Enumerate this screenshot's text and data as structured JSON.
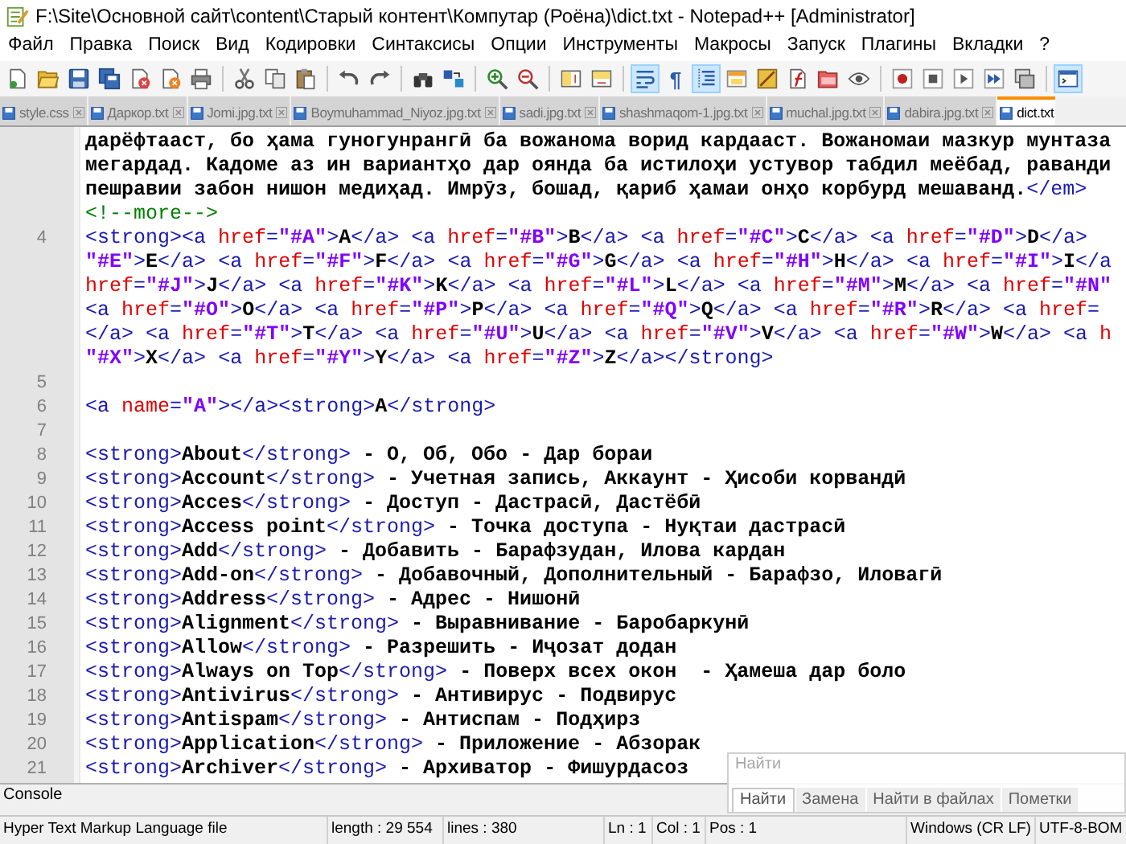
{
  "window": {
    "title": "F:\\Site\\Основной сайт\\content\\Старый контент\\Компутар (Роёна)\\dict.txt - Notepad++ [Administrator]"
  },
  "menu": [
    "Файл",
    "Правка",
    "Поиск",
    "Вид",
    "Кодировки",
    "Синтаксисы",
    "Опции",
    "Инструменты",
    "Макросы",
    "Запуск",
    "Плагины",
    "Вкладки",
    "?"
  ],
  "toolbar": [
    {
      "on": false
    },
    {
      "on": false
    },
    {
      "on": false
    },
    {
      "on": false
    },
    {
      "on": false
    },
    {
      "on": false
    },
    {
      "on": false
    },
    {
      "on": false
    },
    {
      "on": false
    },
    {
      "on": false
    },
    {
      "on": false
    },
    {
      "on": false
    },
    {
      "on": false
    },
    {
      "on": false
    },
    {
      "on": false
    },
    {
      "on": false
    },
    {
      "on": false
    },
    {
      "on": false
    },
    {
      "on": true
    },
    {
      "on": false,
      "symbol": "¶"
    },
    {
      "on": true
    },
    {
      "on": false
    },
    {
      "on": false
    },
    {
      "on": false
    },
    {
      "on": false
    },
    {
      "on": false
    },
    {
      "on": false
    },
    {
      "on": false
    },
    {
      "on": false
    },
    {
      "on": false
    },
    {
      "on": false
    },
    {
      "on": true
    }
  ],
  "tabs": [
    {
      "label": "style.css",
      "selected": false
    },
    {
      "label": "Даркор.txt",
      "selected": false
    },
    {
      "label": "Jomi.jpg.txt",
      "selected": false
    },
    {
      "label": "Boymuhammad_Niyoz.jpg.txt",
      "selected": false
    },
    {
      "label": "sadi.jpg.txt",
      "selected": false
    },
    {
      "label": "shashmaqom-1.jpg.txt",
      "selected": false
    },
    {
      "label": "muchal.jpg.txt",
      "selected": false
    },
    {
      "label": "dabira.jpg.txt",
      "selected": false
    },
    {
      "label": "dict.txt",
      "selected": true
    }
  ],
  "lines": [
    {
      "rows": [
        {
          "text": "дарёфтааст, бо ҳама гуногунрангӣ ба вожанома ворид кардааст. Вожаномаи мазкур мунтаза",
          "kind": "plain"
        },
        {
          "text": "мегардад. Кадоме аз ин вариантҳо дар оянда ба истилоҳи устувор табдил меёбад, раванди",
          "kind": "plain"
        },
        {
          "text": "пешравии забон нишон медиҳад. Имрӯз, бошад, қариб ҳамаи онҳо корбурд мешаванд.</em>",
          "kind": "plain"
        },
        {
          "text": "<!--more-->",
          "kind": "plain"
        }
      ]
    },
    {
      "number": "4",
      "rows": [
        {
          "text": "<strong><a href=\"#A\">A</a> <a href=\"#B\">B</a> <a href=\"#C\">C</a> <a href=\"#D\">D</a>",
          "kind": "plain"
        },
        {
          "text": "\"#E\">E</a> <a href=\"#F\">F</a> <a href=\"#G\">G</a> <a href=\"#H\">H</a> <a href=\"#I\">I</a",
          "kind": "in_tag"
        },
        {
          "text": "href=\"#J\">J</a> <a href=\"#K\">K</a> <a href=\"#L\">L</a> <a href=\"#M\">M</a> <a href=\"#N\"",
          "kind": "in_tag"
        },
        {
          "text": "<a href=\"#O\">O</a> <a href=\"#P\">P</a> <a href=\"#Q\">Q</a> <a href=\"#R\">R</a> <a href=",
          "kind": "plain"
        },
        {
          "text": "</a> <a href=\"#T\">T</a> <a href=\"#U\">U</a> <a href=\"#V\">V</a> <a href=\"#W\">W</a> <a h",
          "kind": "plain"
        },
        {
          "text": "\"#X\">X</a> <a href=\"#Y\">Y</a> <a href=\"#Z\">Z</a></strong>",
          "kind": "in_tag"
        }
      ]
    },
    {
      "number": "5"
    },
    {
      "number": "6",
      "rows": [
        {
          "text": "<a name=\"A\"></a><strong>A</strong>",
          "kind": "plain"
        }
      ]
    },
    {
      "number": "7"
    },
    {
      "number": "8",
      "rows": [
        {
          "text": "<strong>About</strong> - О, Об, Обо - Дар бораи",
          "kind": "plain"
        }
      ]
    },
    {
      "number": "9",
      "rows": [
        {
          "text": "<strong>Account</strong> - Учетная запись, Аккаунт - Ҳисоби корвандӣ",
          "kind": "plain"
        }
      ]
    },
    {
      "number": "10",
      "rows": [
        {
          "text": "<strong>Acces</strong> - Доступ - Дастрасӣ, Дастёбӣ",
          "kind": "plain"
        }
      ]
    },
    {
      "number": "11",
      "rows": [
        {
          "text": "<strong>Access point</strong> - Точка доступа - Нуқтаи дастрасӣ",
          "kind": "plain"
        }
      ]
    },
    {
      "number": "12",
      "rows": [
        {
          "text": "<strong>Add</strong> - Добавить - Барафзудан, Илова кардан",
          "kind": "plain"
        }
      ]
    },
    {
      "number": "13",
      "rows": [
        {
          "text": "<strong>Add-on</strong> - Добавочный, Дополнительный - Барафзо, Иловагӣ",
          "kind": "plain"
        }
      ]
    },
    {
      "number": "14",
      "rows": [
        {
          "text": "<strong>Address</strong> - Адрес - Нишонӣ",
          "kind": "plain"
        }
      ]
    },
    {
      "number": "15",
      "rows": [
        {
          "text": "<strong>Alignment</strong> - Выравнивание - Баробаркунӣ",
          "kind": "plain"
        }
      ]
    },
    {
      "number": "16",
      "rows": [
        {
          "text": "<strong>Allow</strong> - Разрешить - Иҷозат додан",
          "kind": "plain"
        }
      ]
    },
    {
      "number": "17",
      "rows": [
        {
          "text": "<strong>Always on Top</strong> - Поверх всех окон  - Ҳамеша дар боло",
          "kind": "plain"
        }
      ]
    },
    {
      "number": "18",
      "rows": [
        {
          "text": "<strong>Antivirus</strong> - Антивирус - Подвирус",
          "kind": "plain"
        }
      ]
    },
    {
      "number": "19",
      "rows": [
        {
          "text": "<strong>Antispam</strong> - Антиспам - Подҳирз",
          "kind": "plain"
        }
      ]
    },
    {
      "number": "20",
      "rows": [
        {
          "text": "<strong>Application</strong> - Приложение - Абзорак",
          "kind": "plain"
        }
      ]
    },
    {
      "number": "21",
      "rows": [
        {
          "text": "<strong>Archiver</strong> - Архиватор - Фишурдасоз",
          "kind": "plain"
        }
      ]
    }
  ],
  "console": {
    "label": "Console"
  },
  "find_panel": {
    "title": "Найти",
    "tabs": [
      {
        "label": "Найти",
        "selected": true
      },
      {
        "label": "Замена",
        "selected": false
      },
      {
        "label": "Найти в файлах",
        "selected": false
      },
      {
        "label": "Пометки",
        "selected": false
      }
    ]
  },
  "status_bar": [
    "Hyper Text Markup Language file",
    "length : 29 554",
    "lines : 380",
    "Ln : 1",
    "Col : 1",
    "Pos : 1",
    "Windows (CR LF)",
    "UTF-8-BOM"
  ]
}
